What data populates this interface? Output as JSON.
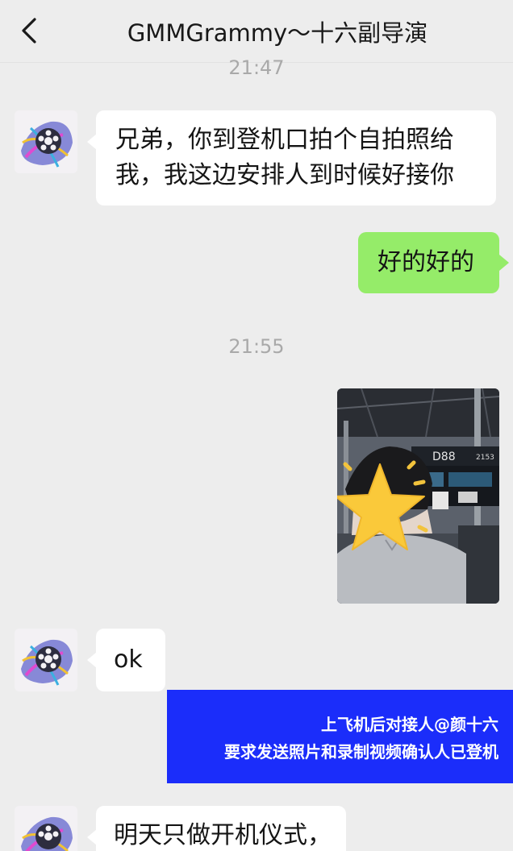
{
  "header": {
    "title": "GMMGrammy～十六副导演",
    "back_icon": "chevron-left-icon"
  },
  "timestamps": [
    "21:47",
    "21:55"
  ],
  "messages": [
    {
      "direction": "incoming",
      "text_lines": [
        "兄弟，你到登机口拍个自拍照给",
        "我，我这边安排人到时候好接你"
      ]
    },
    {
      "direction": "outgoing",
      "text": "好的好的"
    },
    {
      "direction": "outgoing",
      "type": "image",
      "gate_sign": "D88",
      "gate_sign_extra": "2153",
      "face_cover_icon": "star-icon"
    },
    {
      "direction": "incoming",
      "text": "ok"
    },
    {
      "direction": "incoming",
      "text": "明天只做开机仪式，"
    }
  ],
  "banner": {
    "line1": "上飞机后对接人@颜十六",
    "line2": "要求发送照片和录制视频确认人已登机"
  },
  "colors": {
    "background": "#ededed",
    "incoming_bubble": "#ffffff",
    "outgoing_bubble": "#95ec69",
    "banner": "#1b2dfa",
    "timestamp": "#a9a9a9"
  }
}
